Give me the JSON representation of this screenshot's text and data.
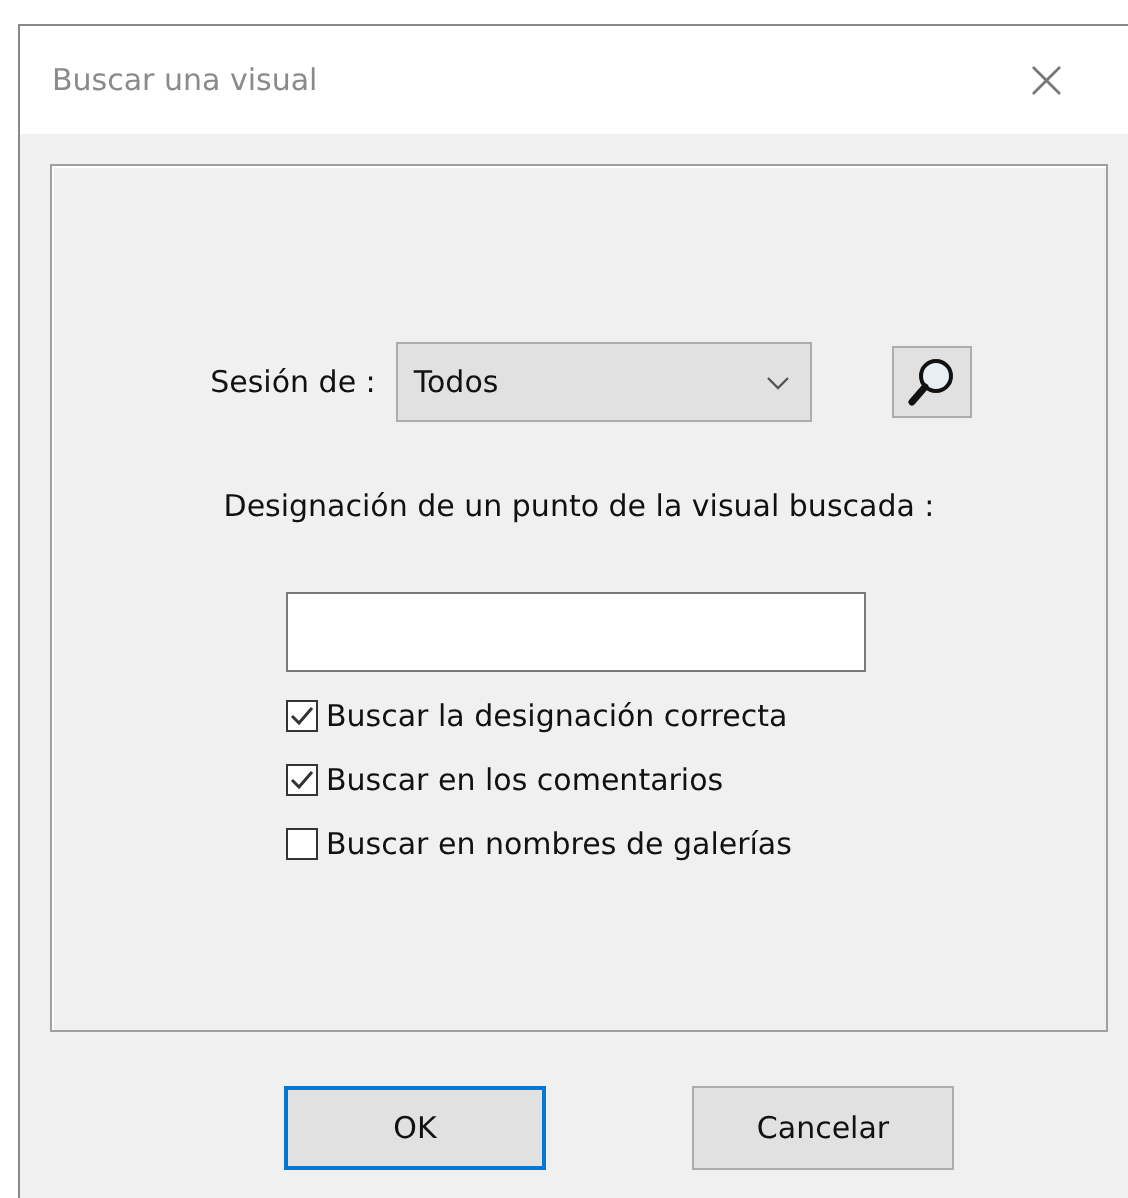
{
  "window": {
    "title": "Buscar una visual",
    "close": "×"
  },
  "session": {
    "label": "Sesión de :",
    "value": "Todos"
  },
  "designation": {
    "label": "Designación de un punto de la visual buscada :"
  },
  "options": [
    {
      "label": "Buscar la designación correcta",
      "checked": true
    },
    {
      "label": "Buscar en los comentarios",
      "checked": true
    },
    {
      "label": "Buscar en nombres de galerías",
      "checked": false
    }
  ],
  "buttons": [
    {
      "label": "OK",
      "default": true
    },
    {
      "label": "Cancelar",
      "default": false
    }
  ]
}
